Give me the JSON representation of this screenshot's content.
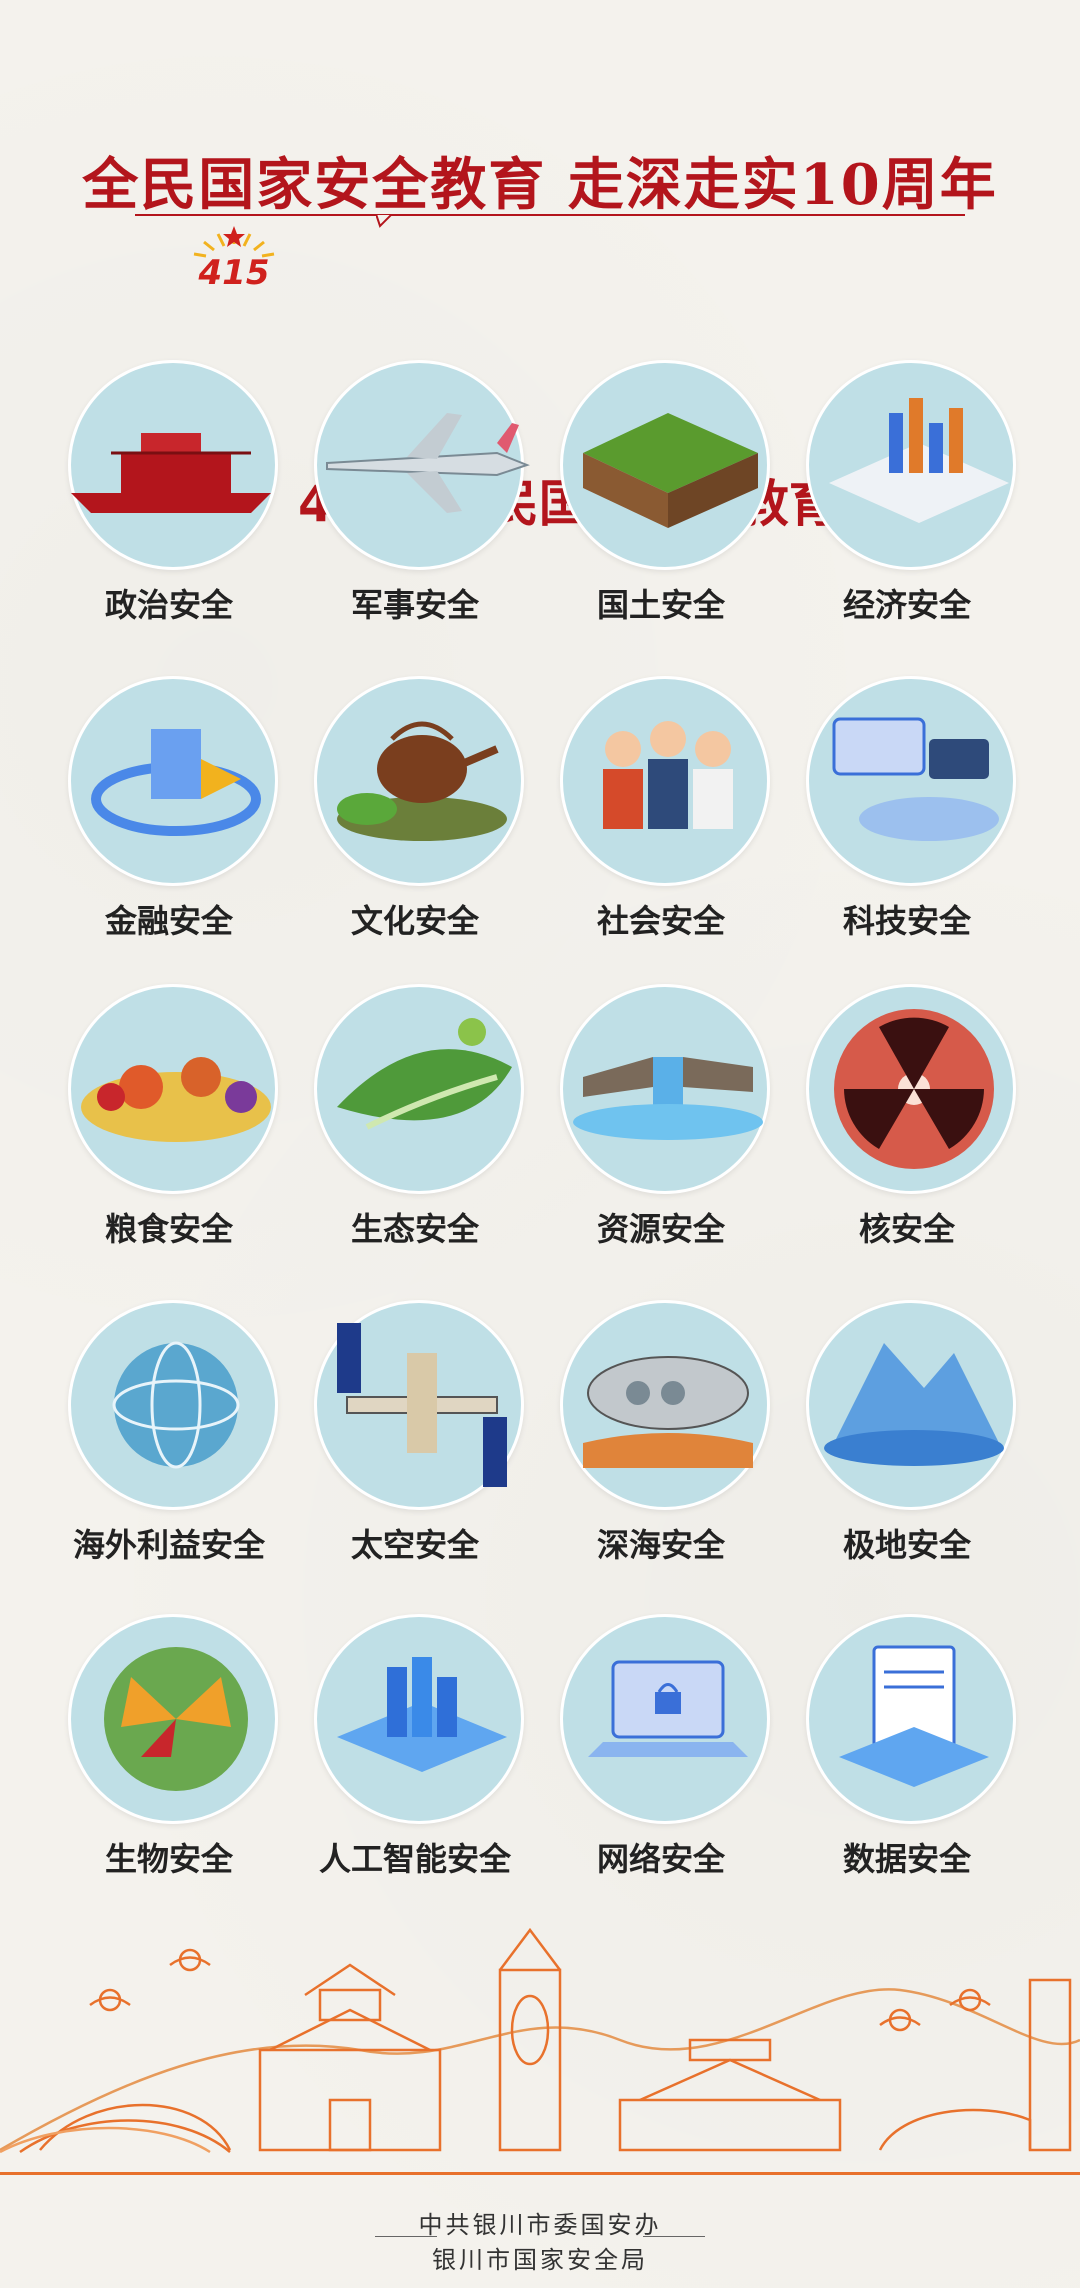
{
  "header": {
    "title_line1": "全民国家安全教育  走深走实10周年",
    "badge": "415",
    "title_line2": "4·15 全民国家安全教育日"
  },
  "topics": [
    {
      "label": "政治安全",
      "icon": "red-boat-icon"
    },
    {
      "label": "军事安全",
      "icon": "fighter-jet-icon"
    },
    {
      "label": "国土安全",
      "icon": "land-block-icon"
    },
    {
      "label": "经济安全",
      "icon": "bar-chart-icon"
    },
    {
      "label": "金融安全",
      "icon": "finance-cube-icon"
    },
    {
      "label": "文化安全",
      "icon": "teapot-icon"
    },
    {
      "label": "社会安全",
      "icon": "people-group-icon"
    },
    {
      "label": "科技安全",
      "icon": "tech-screen-icon"
    },
    {
      "label": "粮食安全",
      "icon": "grain-harvest-icon"
    },
    {
      "label": "生态安全",
      "icon": "green-leaf-icon"
    },
    {
      "label": "资源安全",
      "icon": "waterfall-icon"
    },
    {
      "label": "核安全",
      "icon": "radiation-icon"
    },
    {
      "label": "海外利益安全",
      "icon": "globe-icon"
    },
    {
      "label": "太空安全",
      "icon": "space-station-icon"
    },
    {
      "label": "深海安全",
      "icon": "submarine-icon"
    },
    {
      "label": "极地安全",
      "icon": "iceberg-icon"
    },
    {
      "label": "生物安全",
      "icon": "butterfly-icon"
    },
    {
      "label": "人工智能安全",
      "icon": "ai-chip-icon"
    },
    {
      "label": "网络安全",
      "icon": "laptop-lock-icon"
    },
    {
      "label": "数据安全",
      "icon": "data-document-icon"
    }
  ],
  "footer": {
    "org_line1": "中共银川市委国安办",
    "org_line2": "银川市国家安全局"
  },
  "colors": {
    "title_red": "#b3151c",
    "circle_fill": "#bfdfe6",
    "skyline_orange": "#e8712c"
  }
}
